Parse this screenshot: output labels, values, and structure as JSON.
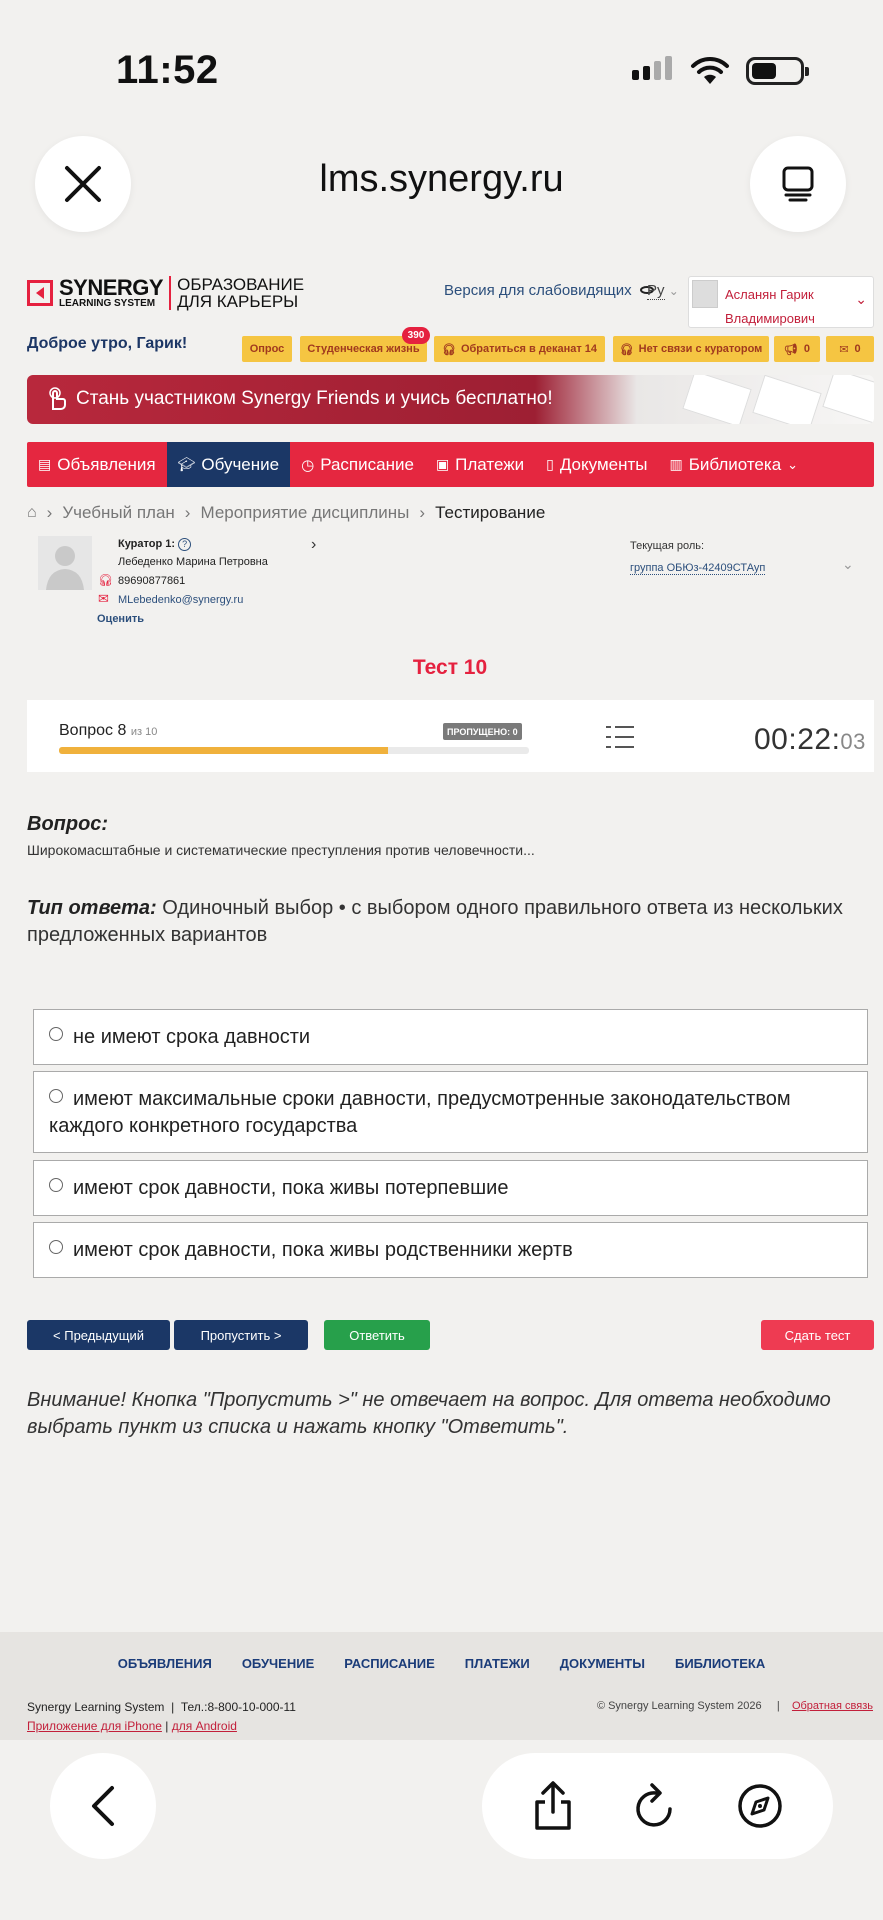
{
  "status": {
    "time": "11:52"
  },
  "browser": {
    "url": "lms.synergy.ru"
  },
  "header": {
    "logo_main": "SYNERGY",
    "logo_sub": "LEARNING SYSTEM",
    "logo_right_1": "ОБРАЗОВАНИЕ",
    "logo_right_2": "ДЛЯ КАРЬЕРЫ",
    "vision_link": "Версия для слабовидящих",
    "lang": "Ру",
    "user_name_1": "Асланян Гарик",
    "user_name_2": "Владимирович",
    "greeting": "Доброе утро, Гарик!"
  },
  "quick": {
    "survey": "Опрос",
    "student_life": "Студенческая жизнь",
    "student_life_badge": "390",
    "dean": "Обратиться в деканат 14",
    "no_curator": "Нет связи с куратором",
    "ann_count": "0",
    "mail_count": "0"
  },
  "banner": {
    "text": "Стань участником Synergy Friends и учись бесплатно!"
  },
  "nav": {
    "ann": "Объявления",
    "edu": "Обучение",
    "sched": "Расписание",
    "pay": "Платежи",
    "docs": "Документы",
    "lib": "Библиотека"
  },
  "breadcrumb": {
    "plan": "Учебный план",
    "event": "Мероприятие дисциплины",
    "current": "Тестирование"
  },
  "curator": {
    "title": "Куратор 1:",
    "name": "Лебеденко Марина Петровна",
    "phone": "89690877861",
    "email": "MLebedenko@synergy.ru",
    "rate": "Оценить"
  },
  "role": {
    "label": "Текущая роль:",
    "value": "группа ОБЮз-42409СТАуп"
  },
  "test": {
    "title": "Тест 10",
    "question_label": "Вопрос 8",
    "question_of": "из 10",
    "skipped": "ПРОПУЩЕНО: 0",
    "progress": 0.7,
    "timer_main": "00:22:",
    "timer_sec": "03",
    "q_head": "Вопрос:",
    "q_text": "Широкомасштабные и систематические преступления против человечности...",
    "type_label": "Тип ответа:",
    "type_text": "Одиночный выбор • с выбором одного правильного ответа из нескольких предложенных вариантов",
    "options": [
      "не имеют срока давности",
      "имеют максимальные сроки давности, предусмотренные законодательством каждого конкретного государства",
      "имеют срок давности, пока живы потерпевшие",
      "имеют срок давности, пока живы родственники жертв"
    ],
    "btn_prev": "< Предыдущий",
    "btn_skip": "Пропустить >",
    "btn_answer": "Ответить",
    "btn_submit": "Сдать тест",
    "warning": "Внимание! Кнопка \"Пропустить >\" не отвечает на вопрос. Для ответа необходимо выбрать пункт из списка и нажать кнопку \"Ответить\"."
  },
  "footer": {
    "nav": [
      "ОБЪЯВЛЕНИЯ",
      "ОБУЧЕНИЕ",
      "РАСПИСАНИЕ",
      "ПЛАТЕЖИ",
      "ДОКУМЕНТЫ",
      "БИБЛИОТЕКА"
    ],
    "company": "Synergy Learning System",
    "phone": "Тел.:8-800-10-000-11",
    "iphone": "Приложение для iPhone",
    "android": "для Android",
    "copyright": "© Synergy Learning System 2026",
    "feedback": "Обратная связь"
  },
  "colors": {
    "brand_red": "#e52740",
    "nav_active": "#1b3766",
    "answer_green": "#27a04b",
    "progress": "#f0b13c"
  }
}
